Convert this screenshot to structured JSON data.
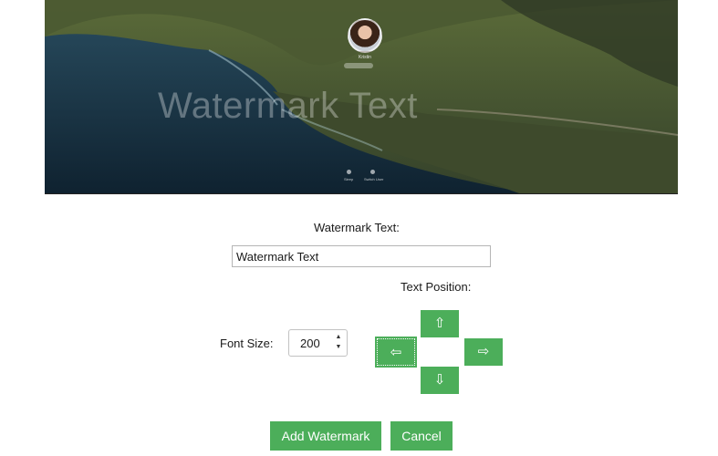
{
  "preview": {
    "watermark_overlay": "Watermark Text",
    "lock_user_name": "Kristin",
    "bottom_left_label": "Sleep",
    "bottom_right_label": "Switch User"
  },
  "watermark_text_label": "Watermark Text:",
  "watermark_text_value": "Watermark Text",
  "text_position_label": "Text Position:",
  "font_size_label": "Font Size:",
  "font_size_value": "200",
  "position_buttons": {
    "up": "⇧",
    "left": "⇦",
    "right": "⇨",
    "down": "⇩",
    "selected": "left"
  },
  "add_watermark_label": "Add Watermark",
  "cancel_label": "Cancel",
  "colors": {
    "button_green": "#4cae5a"
  },
  "icons": {
    "spin_up": "spin-up-icon",
    "spin_down": "spin-down-icon"
  }
}
